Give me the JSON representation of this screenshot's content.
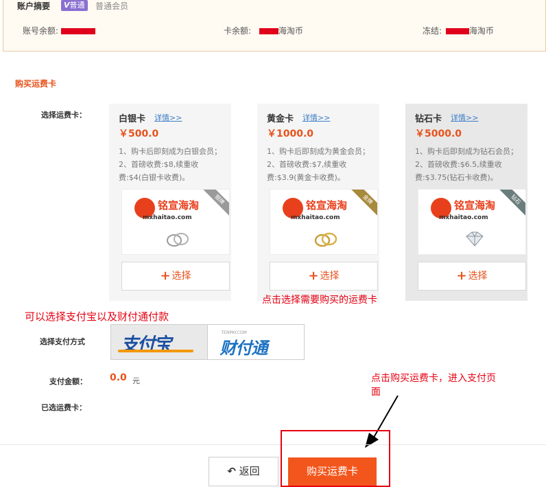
{
  "summary": {
    "title": "账户摘要",
    "vip_badge": "V普通",
    "vip_v": "V",
    "vip_text": "普通",
    "member_level": "普通会员",
    "account_balance_label": "账号余额:",
    "card_balance_label": "卡余额:",
    "card_balance_unit": "海淘币",
    "frozen_label": "冻结:",
    "frozen_unit": "海淘币"
  },
  "section_title": "购买运费卡",
  "labels": {
    "select_card": "选择运费卡：",
    "select_payment": "选择支付方式",
    "pay_amount": "支付金额：",
    "selected_card": "已选运费卡："
  },
  "cards": [
    {
      "name": "白银卡",
      "detail": "详情>>",
      "price": "￥500.0",
      "desc_line1": "1、购卡后即刻成为白银会员；",
      "desc_line2": "2、首磅收费:$8,续重收费:$4(白银卡收费)。",
      "logo_text": "铭宣海淘",
      "logo_sub": "mxhaitao.com",
      "corner": "银牌",
      "corner_color": "#9a9a9a",
      "select_label": "选择"
    },
    {
      "name": "黄金卡",
      "detail": "详情>>",
      "price": "￥1000.0",
      "desc_line1": "1、购卡后即刻成为黄金会员；",
      "desc_line2": "2、首磅收费:$7,续重收费:$3.9(黄金卡收费)。",
      "logo_text": "铭宣海淘",
      "logo_sub": "mxhaitao.com",
      "corner": "金牌",
      "corner_color": "#a88a3c",
      "select_label": "选择"
    },
    {
      "name": "钻石卡",
      "detail": "详情>>",
      "price": "￥5000.0",
      "desc_line1": "1、购卡后即刻成为钻石会员；",
      "desc_line2": "2、首磅收费:$6.5,续重收费:$3.75(钻石卡收费)。",
      "logo_text": "铭宣海淘",
      "logo_sub": "mxhaitao.com",
      "corner": "钻石",
      "corner_color": "#6b7c7c",
      "select_label": "选择"
    }
  ],
  "annotations": {
    "payment_hint": "可以选择支付宝以及财付通付款",
    "card_hint": "点击选择需要购买的运费卡",
    "buy_hint_line1": "点击购买运费卡，进入支付页",
    "buy_hint_line2": "面"
  },
  "payment": {
    "alipay": "支付宝",
    "tenpay_small": "TENPAY.COM",
    "tenpay": "财付通"
  },
  "amount": {
    "value": "0.0",
    "unit": "元"
  },
  "buttons": {
    "back": "返回",
    "back_icon": "undo-arrow-icon",
    "buy": "购买运费卡"
  },
  "colors": {
    "accent": "#e8521c",
    "annotation": "#e60012",
    "link": "#3a7cc6"
  }
}
